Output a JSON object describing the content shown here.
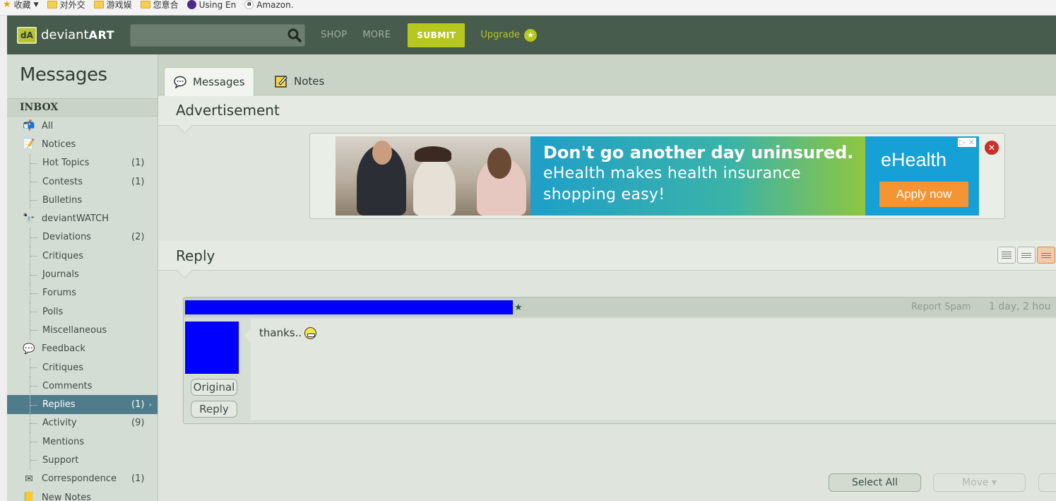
{
  "browser": {
    "favorites": [
      {
        "label": "收藏",
        "icon": "star-icon"
      },
      {
        "label": "对外交",
        "icon": "folder-icon"
      },
      {
        "label": "游戏娱",
        "icon": "folder-icon"
      },
      {
        "label": "您意合",
        "icon": "folder-icon"
      },
      {
        "label": "Using En",
        "icon": "globe-icon"
      },
      {
        "label": "Amazon.",
        "icon": "amazon-icon"
      }
    ]
  },
  "topnav": {
    "logo_prefix": "deviant",
    "logo_suffix": "ART",
    "search_placeholder": "",
    "shop_label": "SHOP",
    "more_label": "MORE",
    "submit_label": "SUBMIT",
    "upgrade_label": "Upgrade"
  },
  "sidebar": {
    "title": "Messages",
    "inbox_label": "INBOX",
    "items": [
      {
        "label": "All",
        "level": "top",
        "icon": "mailbox-icon",
        "count": ""
      },
      {
        "label": "Notices",
        "level": "top",
        "icon": "notice-icon",
        "count": ""
      },
      {
        "label": "Hot Topics",
        "level": "sub",
        "count": "(1)"
      },
      {
        "label": "Contests",
        "level": "sub",
        "count": "(1)"
      },
      {
        "label": "Bulletins",
        "level": "sub",
        "count": ""
      },
      {
        "label": "deviantWATCH",
        "level": "top",
        "icon": "binoculars-icon",
        "count": ""
      },
      {
        "label": "Deviations",
        "level": "sub",
        "count": "(2)"
      },
      {
        "label": "Critiques",
        "level": "sub",
        "count": ""
      },
      {
        "label": "Journals",
        "level": "sub",
        "count": ""
      },
      {
        "label": "Forums",
        "level": "sub",
        "count": ""
      },
      {
        "label": "Polls",
        "level": "sub",
        "count": ""
      },
      {
        "label": "Miscellaneous",
        "level": "sub",
        "count": ""
      },
      {
        "label": "Feedback",
        "level": "top",
        "icon": "speech-bubble-icon",
        "count": ""
      },
      {
        "label": "Critiques",
        "level": "sub",
        "count": ""
      },
      {
        "label": "Comments",
        "level": "sub",
        "count": ""
      },
      {
        "label": "Replies",
        "level": "sub",
        "count": "(1)",
        "active": true
      },
      {
        "label": "Activity",
        "level": "sub",
        "count": "(9)"
      },
      {
        "label": "Mentions",
        "level": "sub",
        "count": ""
      },
      {
        "label": "Support",
        "level": "sub",
        "count": ""
      },
      {
        "label": "Correspondence",
        "level": "top",
        "icon": "envelope-icon",
        "count": "(1)"
      },
      {
        "label": "New Notes",
        "level": "top",
        "icon": "note-icon",
        "count": ""
      }
    ]
  },
  "tabs": {
    "messages_label": "Messages",
    "notes_label": "Notes"
  },
  "advertisement": {
    "header": "Advertisement",
    "headline": "Don't go another day uninsured.",
    "subline_1": "eHealth makes health insurance",
    "subline_2": "shopping easy!",
    "brand": "eHealth",
    "cta": "Apply now"
  },
  "reply_section": {
    "header": "Reply",
    "message": {
      "report_spam": "Report Spam",
      "time": "1 day, 2 hou",
      "text": "thanks..",
      "original_label": "Original",
      "reply_label": "Reply"
    }
  },
  "actions": {
    "select_all": "Select All",
    "move": "Move ▾"
  },
  "colors": {
    "nav_bg": "#475c4d",
    "accent": "#b6c71d",
    "active_item": "#4f7b8a",
    "redaction": "#0000ff"
  }
}
